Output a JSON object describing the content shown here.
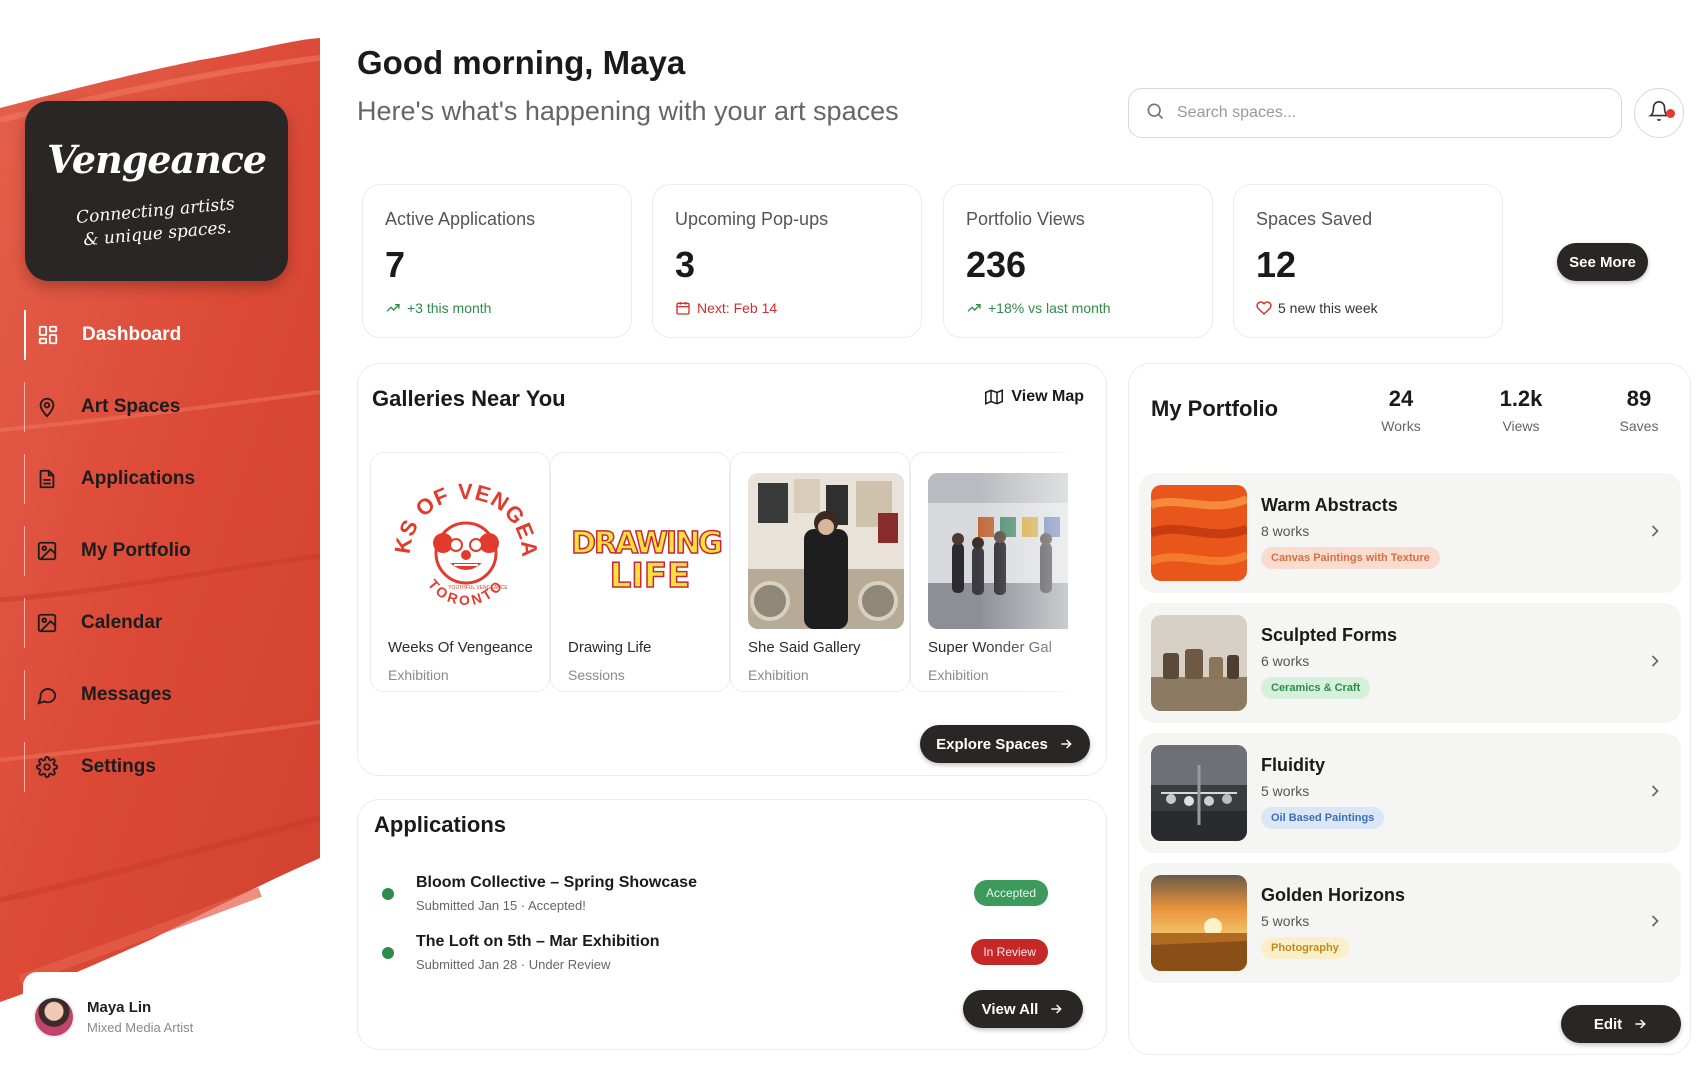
{
  "brand": {
    "name": "Vengeance",
    "tagline_line1": "Connecting artists",
    "tagline_line2": "& unique spaces."
  },
  "nav": [
    {
      "label": "Dashboard",
      "icon": "grid-icon",
      "active": true
    },
    {
      "label": "Art Spaces",
      "icon": "map-pin-icon"
    },
    {
      "label": "Applications",
      "icon": "document-icon"
    },
    {
      "label": "My Portfolio",
      "icon": "image-icon"
    },
    {
      "label": "Calendar",
      "icon": "image-icon"
    },
    {
      "label": "Messages",
      "icon": "chat-bubble-icon"
    },
    {
      "label": "Settings",
      "icon": "gear-icon"
    }
  ],
  "user": {
    "name": "Maya Lin",
    "role": "Mixed Media Artist"
  },
  "header": {
    "greeting": "Good morning, Maya",
    "subtitle": "Here's what's happening with your art spaces"
  },
  "search": {
    "placeholder": "Search spaces..."
  },
  "stats": [
    {
      "label": "Active Applications",
      "value": "7",
      "note": "+3 this month",
      "note_icon": "trend-up-icon",
      "note_color": "#2e8b4c"
    },
    {
      "label": "Upcoming Pop-ups",
      "value": "3",
      "note": "Next: Feb 14",
      "note_icon": "calendar-icon",
      "note_color": "#d32f2f"
    },
    {
      "label": "Portfolio Views",
      "value": "236",
      "note": "+18% vs last month",
      "note_icon": "trend-up-icon",
      "note_color": "#2e8b4c"
    },
    {
      "label": "Spaces Saved",
      "value": "12",
      "note": "5 new this week",
      "note_icon": "heart-icon",
      "note_color": "#333333"
    }
  ],
  "see_more_label": "See More",
  "galleries": {
    "title": "Galleries Near You",
    "view_map_label": "View Map",
    "explore_label": "Explore Spaces",
    "items": [
      {
        "name": "Weeks Of Vengeance",
        "type": "Exhibition",
        "logo_top": "WEEKS OF VENGEANCE",
        "logo_small": "YOUTHFUL VENGEANCE",
        "logo_bottom": "TORONTO"
      },
      {
        "name": "Drawing Life",
        "type": "Sessions",
        "logo_top": "DRAWING",
        "logo_bottom": "LIFE"
      },
      {
        "name": "She Said Gallery",
        "type": "Exhibition"
      },
      {
        "name": "Super Wonder Gal",
        "type": "Exhibition"
      }
    ]
  },
  "applications": {
    "title": "Applications",
    "view_all_label": "View All",
    "items": [
      {
        "title": "Bloom Collective – Spring Showcase",
        "sub": "Submitted Jan 15 · Accepted!",
        "status": "Accepted"
      },
      {
        "title": "The Loft on 5th – Mar Exhibition",
        "sub": "Submitted Jan 28 · Under Review",
        "status": "In Review"
      }
    ]
  },
  "portfolio": {
    "title": "My Portfolio",
    "stats": [
      {
        "value": "24",
        "label": "Works"
      },
      {
        "value": "1.2k",
        "label": "Views"
      },
      {
        "value": "89",
        "label": "Saves"
      }
    ],
    "items": [
      {
        "title": "Warm Abstracts",
        "count": "8 works",
        "tag": "Canvas Paintings with Texture",
        "tag_bg": "#f9dccf",
        "tag_fg": "#d4703f"
      },
      {
        "title": "Sculpted Forms",
        "count": "6 works",
        "tag": "Ceramics & Craft",
        "tag_bg": "#d6f0dc",
        "tag_fg": "#2e8b4c"
      },
      {
        "title": "Fluidity",
        "count": "5 works",
        "tag": "Oil Based Paintings",
        "tag_bg": "#dbe6f6",
        "tag_fg": "#3d6fb3"
      },
      {
        "title": "Golden Horizons",
        "count": "5 works",
        "tag": "Photography",
        "tag_bg": "#fbefc9",
        "tag_fg": "#c08a1b"
      }
    ],
    "edit_label": "Edit"
  },
  "colors": {
    "accent": "#e0523f",
    "dark": "#2a2625",
    "accepted": "#3b9a5c",
    "review": "#c62828"
  }
}
